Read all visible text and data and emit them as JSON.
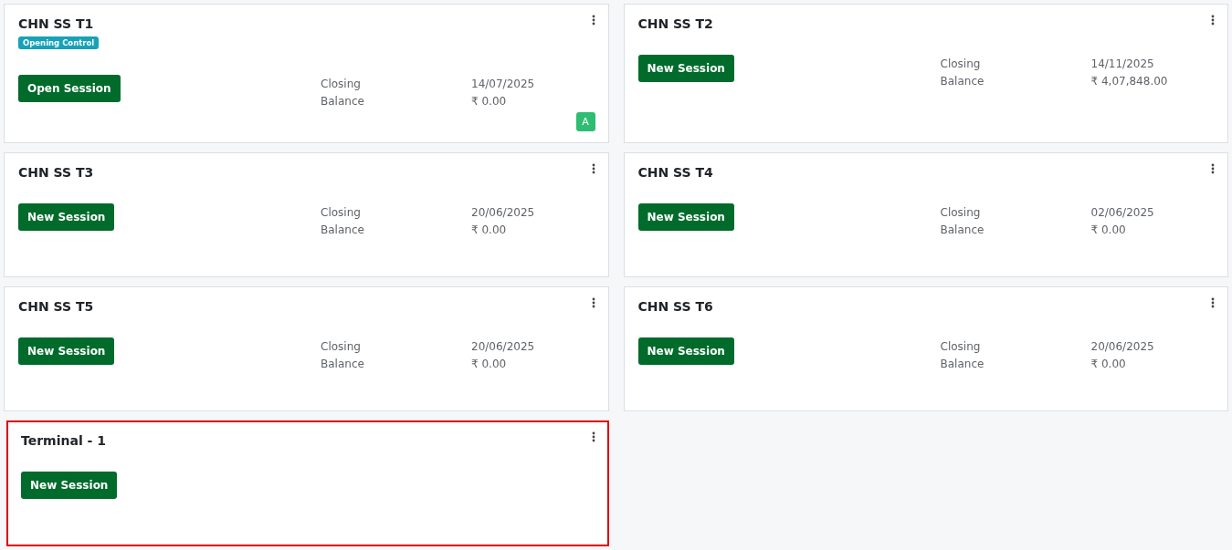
{
  "terminals": [
    {
      "name": "CHN SS T1",
      "badge": "Opening Control",
      "button": "Open Session",
      "highlighted": false,
      "stats": [
        {
          "label": "Closing",
          "value": "14/07/2025"
        },
        {
          "label": "Balance",
          "value": "₹ 0.00"
        }
      ],
      "avatar": "A"
    },
    {
      "name": "CHN SS T2",
      "button": "New Session",
      "highlighted": false,
      "stats": [
        {
          "label": "Closing",
          "value": "14/11/2025"
        },
        {
          "label": "Balance",
          "value": "₹ 4,07,848.00"
        }
      ]
    },
    {
      "name": "CHN SS T3",
      "button": "New Session",
      "highlighted": false,
      "stats": [
        {
          "label": "Closing",
          "value": "20/06/2025"
        },
        {
          "label": "Balance",
          "value": "₹ 0.00"
        }
      ]
    },
    {
      "name": "CHN SS T4",
      "button": "New Session",
      "highlighted": false,
      "stats": [
        {
          "label": "Closing",
          "value": "02/06/2025"
        },
        {
          "label": "Balance",
          "value": "₹ 0.00"
        }
      ]
    },
    {
      "name": "CHN SS T5",
      "button": "New Session",
      "highlighted": false,
      "stats": [
        {
          "label": "Closing",
          "value": "20/06/2025"
        },
        {
          "label": "Balance",
          "value": "₹ 0.00"
        }
      ]
    },
    {
      "name": "CHN SS T6",
      "button": "New Session",
      "highlighted": false,
      "stats": [
        {
          "label": "Closing",
          "value": "20/06/2025"
        },
        {
          "label": "Balance",
          "value": "₹ 0.00"
        }
      ]
    },
    {
      "name": "Terminal - 1",
      "button": "New Session",
      "highlighted": true
    }
  ]
}
